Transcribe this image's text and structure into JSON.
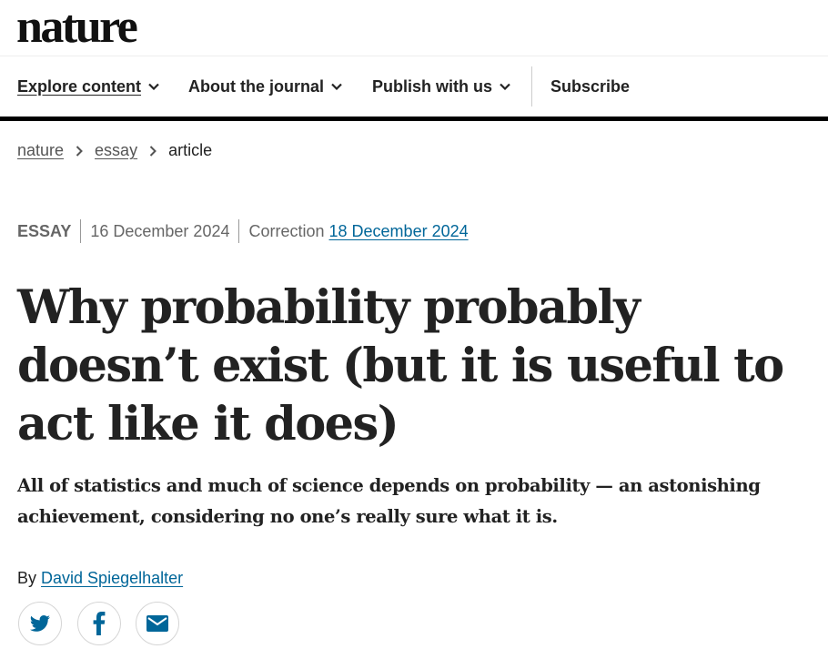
{
  "logo": {
    "text": "nature"
  },
  "nav": {
    "items": [
      {
        "label": "Explore content"
      },
      {
        "label": "About the journal"
      },
      {
        "label": "Publish with us"
      }
    ],
    "subscribe_label": "Subscribe"
  },
  "breadcrumb": {
    "items": [
      "nature",
      "essay",
      "article"
    ]
  },
  "meta": {
    "type": "ESSAY",
    "published": "16 December 2024",
    "correction_label": "Correction",
    "correction_date": "18 December 2024"
  },
  "article": {
    "title": "Why probability probably doesn’t exist (but it is useful to act like it does)",
    "standfirst": "All of statistics and much of science depends on probability — an astonishing achievement, considering no one’s really sure what it is.",
    "byline_prefix": "By",
    "author": "David Spiegelhalter"
  },
  "share": {
    "icons": [
      "twitter-icon",
      "facebook-icon",
      "email-icon"
    ]
  },
  "colors": {
    "link": "#006699",
    "text": "#222222",
    "muted": "#666666",
    "nav_rule": "#000000"
  }
}
